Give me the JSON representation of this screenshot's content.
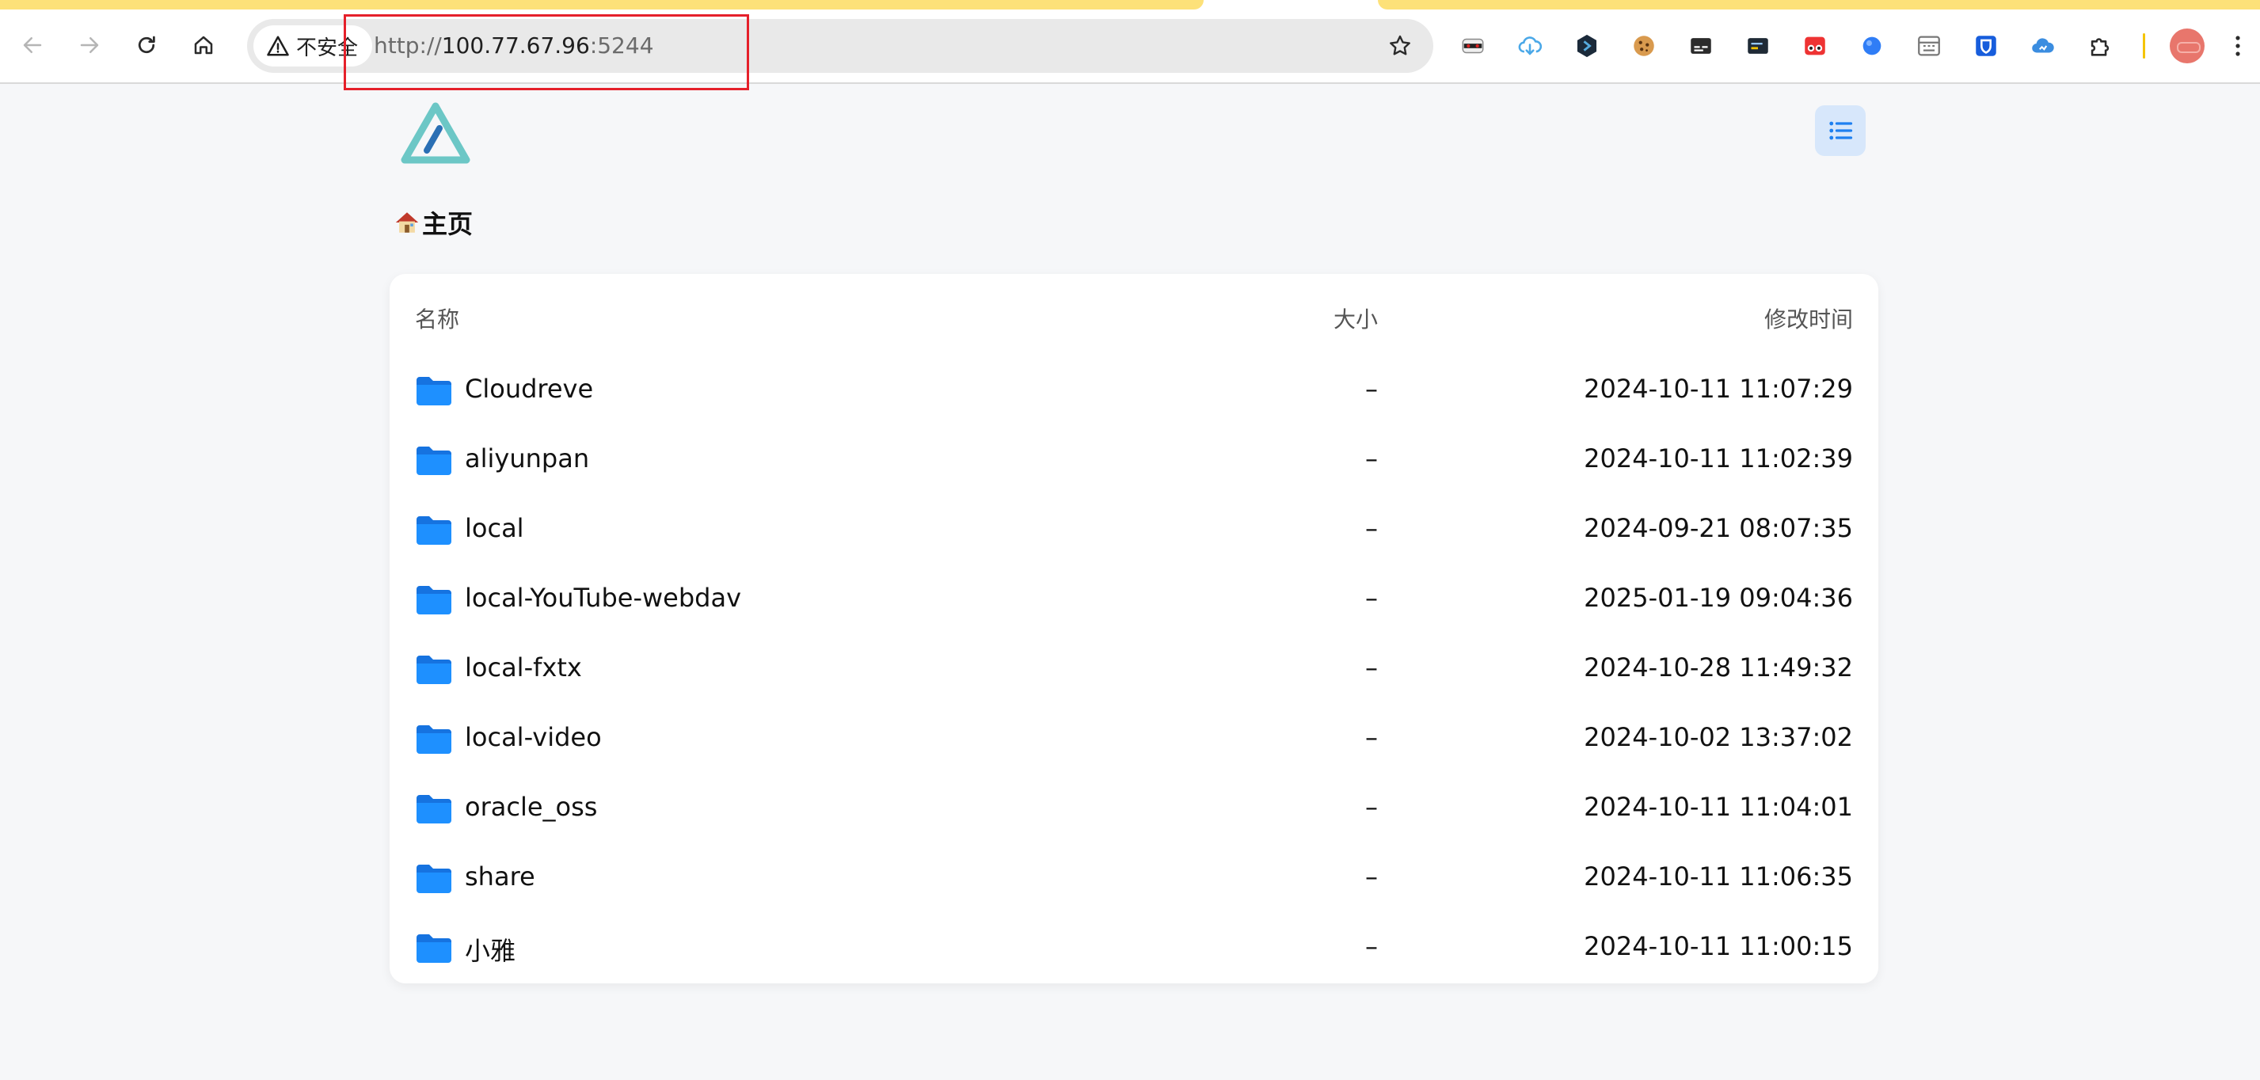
{
  "browser": {
    "security_label": "不安全",
    "url": {
      "scheme": "http://",
      "host": "100.77.67.96",
      "port": ":5244"
    }
  },
  "extensions": [
    "incognito-mask-icon",
    "cloud-download-icon",
    "hexagon-extension-icon",
    "cookie-icon",
    "subtitles-icon",
    "terminal-card-icon",
    "red-eyes-extension-icon",
    "blue-dot-icon",
    "grid-keyboard-icon",
    "bitwarden-shield-icon",
    "cloud-sync-icon",
    "puzzle-piece-icon"
  ],
  "page": {
    "breadcrumb": {
      "icon": "house-icon",
      "label": "主页"
    },
    "table": {
      "headers": {
        "name": "名称",
        "size": "大小",
        "modified": "修改时间"
      },
      "rows": [
        {
          "name": "Cloudreve",
          "size": "–",
          "modified": "2024-10-11 11:07:29"
        },
        {
          "name": "aliyunpan",
          "size": "–",
          "modified": "2024-10-11 11:02:39"
        },
        {
          "name": "local",
          "size": "–",
          "modified": "2024-09-21 08:07:35"
        },
        {
          "name": "local-YouTube-webdav",
          "size": "–",
          "modified": "2025-01-19 09:04:36"
        },
        {
          "name": "local-fxtx",
          "size": "–",
          "modified": "2024-10-28 11:49:32"
        },
        {
          "name": "local-video",
          "size": "–",
          "modified": "2024-10-02 13:37:02"
        },
        {
          "name": "oracle_oss",
          "size": "–",
          "modified": "2024-10-11 11:04:01"
        },
        {
          "name": "share",
          "size": "–",
          "modified": "2024-10-11 11:06:35"
        },
        {
          "name": "小雅",
          "size": "–",
          "modified": "2024-10-11 11:00:15"
        }
      ]
    }
  },
  "colors": {
    "folder": "#1e90ff",
    "logo": "#6cc7c6",
    "highlight": "#e5202a",
    "menu_bg": "#d7e7fb",
    "accent": "#1e80f0"
  }
}
